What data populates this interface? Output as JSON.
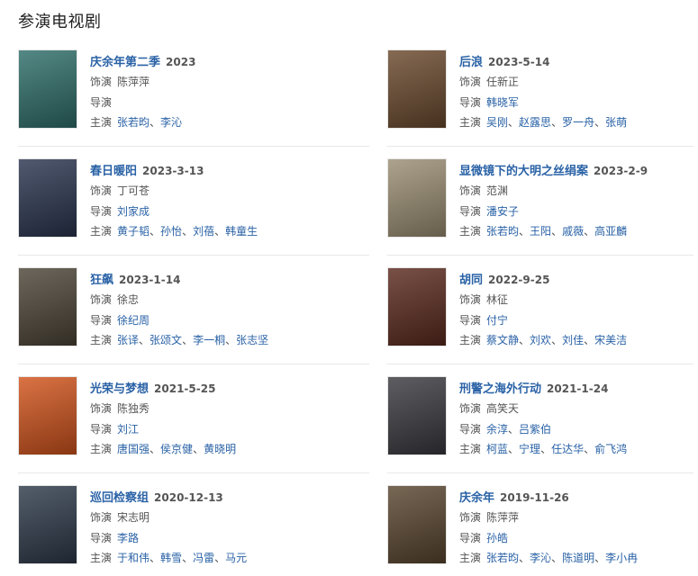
{
  "section_title": "参演电视剧",
  "labels": {
    "role": "饰演",
    "director": "导演",
    "cast": "主演",
    "sep": "、"
  },
  "colors": {
    "link": "#2a62a6",
    "text": "#555555"
  },
  "shows": [
    {
      "title": "庆余年第二季",
      "date": "2023",
      "role": "陈萍萍",
      "director": [],
      "cast": [
        "张若昀",
        "李沁"
      ],
      "poster_color": "#2f6f6a",
      "poster_icon": "poster-image"
    },
    {
      "title": "后浪",
      "date": "2023-5-14",
      "role": "任新正",
      "director": [
        "韩晓军"
      ],
      "cast": [
        "吴刚",
        "赵露思",
        "罗一舟",
        "张萌"
      ],
      "poster_color": "#6b4a2e",
      "poster_icon": "poster-image"
    },
    {
      "title": "春日暖阳",
      "date": "2023-3-13",
      "role": "丁可苍",
      "director": [
        "刘家成"
      ],
      "cast": [
        "黄子韬",
        "孙怡",
        "刘蓓",
        "韩童生"
      ],
      "poster_color": "#2b3550",
      "poster_icon": "poster-image"
    },
    {
      "title": "显微镜下的大明之丝绢案",
      "date": "2023-2-9",
      "role": "范渊",
      "director": [
        "潘安子"
      ],
      "cast": [
        "张若昀",
        "王阳",
        "戚薇",
        "高亚麟"
      ],
      "poster_color": "#9c8f74",
      "poster_icon": "poster-image"
    },
    {
      "title": "狂飙",
      "date": "2023-1-14",
      "role": "徐忠",
      "director": [
        "徐纪周"
      ],
      "cast": [
        "张译",
        "张颂文",
        "李一桐",
        "张志坚"
      ],
      "poster_color": "#4d4538",
      "poster_icon": "poster-image"
    },
    {
      "title": "胡同",
      "date": "2022-9-25",
      "role": "林征",
      "director": [
        "付宁"
      ],
      "cast": [
        "蔡文静",
        "刘欢",
        "刘佳",
        "宋美洁"
      ],
      "poster_color": "#5b2a1e",
      "poster_icon": "poster-image"
    },
    {
      "title": "光荣与梦想",
      "date": "2021-5-25",
      "role": "陈独秀",
      "director": [
        "刘江"
      ],
      "cast": [
        "唐国强",
        "侯京健",
        "黄晓明"
      ],
      "poster_color": "#d2541c",
      "poster_icon": "poster-image"
    },
    {
      "title": "刑警之海外行动",
      "date": "2021-1-24",
      "role": "高笑天",
      "director": [
        "余淳",
        "吕紫伯"
      ],
      "cast": [
        "柯蓝",
        "宁理",
        "任达华",
        "俞飞鸿"
      ],
      "poster_color": "#3a3a40",
      "poster_icon": "poster-image"
    },
    {
      "title": "巡回检察组",
      "date": "2020-12-13",
      "role": "宋志明",
      "director": [
        "李路"
      ],
      "cast": [
        "于和伟",
        "韩雪",
        "冯雷",
        "马元"
      ],
      "poster_color": "#2e3a4a",
      "poster_icon": "poster-image"
    },
    {
      "title": "庆余年",
      "date": "2019-11-26",
      "role": "陈萍萍",
      "director": [
        "孙皓"
      ],
      "cast": [
        "张若昀",
        "李沁",
        "陈道明",
        "李小冉"
      ],
      "poster_color": "#5a4630",
      "poster_icon": "poster-image"
    }
  ]
}
